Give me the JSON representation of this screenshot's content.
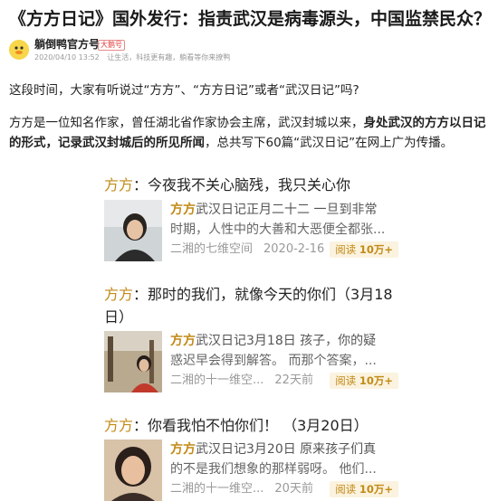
{
  "article": {
    "title": "《方方日记》国外发行：指责武汉是病毒源头，中国监禁民众？",
    "author": {
      "name": "躺倒鸭官方号",
      "badge": "大鹅号",
      "date": "2020/04/10 13:52",
      "meta2": "让生活，科技更有趣，躺看等你来撩鸭"
    },
    "paragraph1": "这段时间，大家有听说过“方方”、“方方日记”或者“武汉日记”吗?",
    "paragraph2_a": "方方是一位知名作家，曾任湖北省作家协会主席，武汉封城以来，",
    "paragraph2_bold": "身处武汉的方方以日记的形式，记录武汉封城后的所见所闻",
    "paragraph2_b": "，总共写下60篇“武汉日记”在网上广为传播。"
  },
  "cards": [
    {
      "heading_who": "方方",
      "heading_rest": "：今夜我不关心脑残，我只关心你",
      "summary_who": "方方",
      "summary_line1": "武汉日记正月二十二 一旦到非常",
      "summary_line2": "时期，人性中的大善和大恶便全都张...",
      "source": "二湘的七维空间",
      "date": "2020-2-16",
      "read_label": "阅读",
      "read_count": "10万+"
    },
    {
      "heading_who": "方方",
      "heading_rest": "：那时的我们，就像今天的你们（3月18日）",
      "summary_who": "方方",
      "summary_line1": "武汉日记3月18日 孩子，你的疑",
      "summary_line2": "惑迟早会得到解答。 而那个答案，...",
      "source": "二湘的十一维空...",
      "date": "22天前",
      "read_label": "阅读",
      "read_count": "10万+"
    },
    {
      "heading_who": "方方",
      "heading_rest": "：你看我怕不怕你们！ （3月20日）",
      "summary_who": "方方",
      "summary_line1": "武汉日记3月20日 原来孩子们真",
      "summary_line2": "的不是我们想象的那样弱呀。 他们...",
      "source": "二湘的十一维空...",
      "date": "20天前",
      "read_label": "阅读",
      "read_count": "10万+"
    }
  ]
}
